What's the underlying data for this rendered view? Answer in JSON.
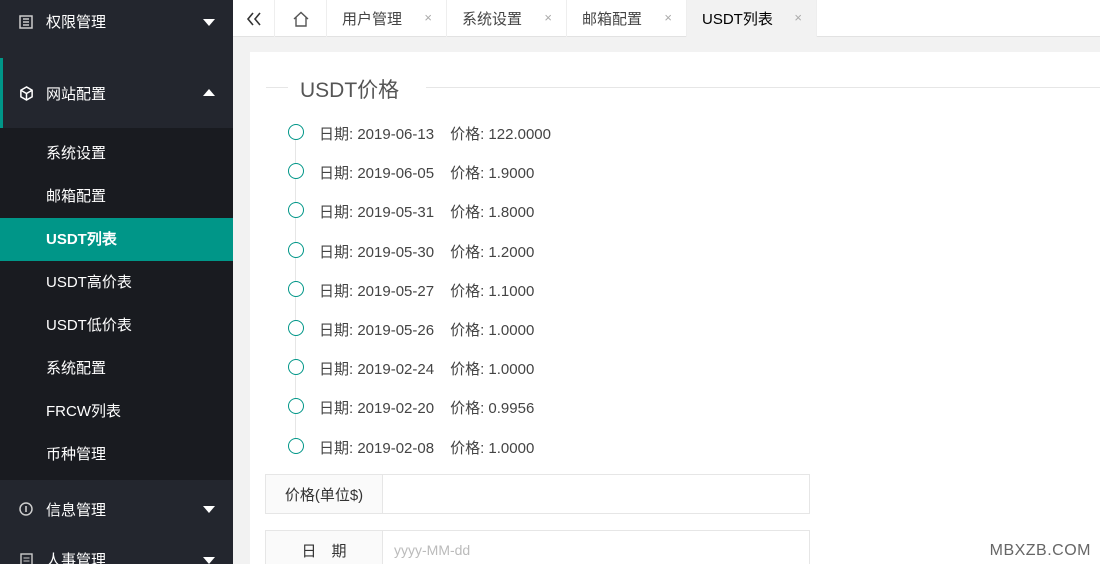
{
  "sidebar": {
    "groups": [
      {
        "label": "权限管理",
        "icon": "permission-icon"
      },
      {
        "label": "网站配置",
        "icon": "cube-icon"
      },
      {
        "label": "信息管理",
        "icon": "info-icon"
      },
      {
        "label": "人事管理",
        "icon": "document-icon"
      }
    ],
    "sub_items": [
      "系统设置",
      "邮箱配置",
      "USDT列表",
      "USDT高价表",
      "USDT低价表",
      "系统配置",
      "FRCW列表",
      "币种管理"
    ],
    "active_item": "USDT列表",
    "accent_color": "#009688",
    "bg_color": "#23262e"
  },
  "tabs": {
    "items": [
      {
        "label": "用户管理",
        "close": "×"
      },
      {
        "label": "系统设置",
        "close": "×"
      },
      {
        "label": "邮箱配置",
        "close": "×"
      },
      {
        "label": "USDT列表",
        "close": "×"
      }
    ]
  },
  "content": {
    "section_title": "USDT价格",
    "timeline": [
      {
        "date": "日期: 2019-06-13",
        "price": "价格: 122.0000"
      },
      {
        "date": "日期: 2019-06-05",
        "price": "价格: 1.9000"
      },
      {
        "date": "日期: 2019-05-31",
        "price": "价格: 1.8000"
      },
      {
        "date": "日期: 2019-05-30",
        "price": "价格: 1.2000"
      },
      {
        "date": "日期: 2019-05-27",
        "price": "价格: 1.1000"
      },
      {
        "date": "日期: 2019-05-26",
        "price": "价格: 1.0000"
      },
      {
        "date": "日期: 2019-02-24",
        "price": "价格: 1.0000"
      },
      {
        "date": "日期: 2019-02-20",
        "price": "价格: 0.9956"
      },
      {
        "date": "日期: 2019-02-08",
        "price": "价格: 1.0000"
      }
    ],
    "form": {
      "price_label": "价格(单位$)",
      "price_value": "",
      "date_label": "日　期",
      "date_placeholder": "yyyy-MM-dd"
    }
  },
  "watermark": "MBXZB.COM"
}
